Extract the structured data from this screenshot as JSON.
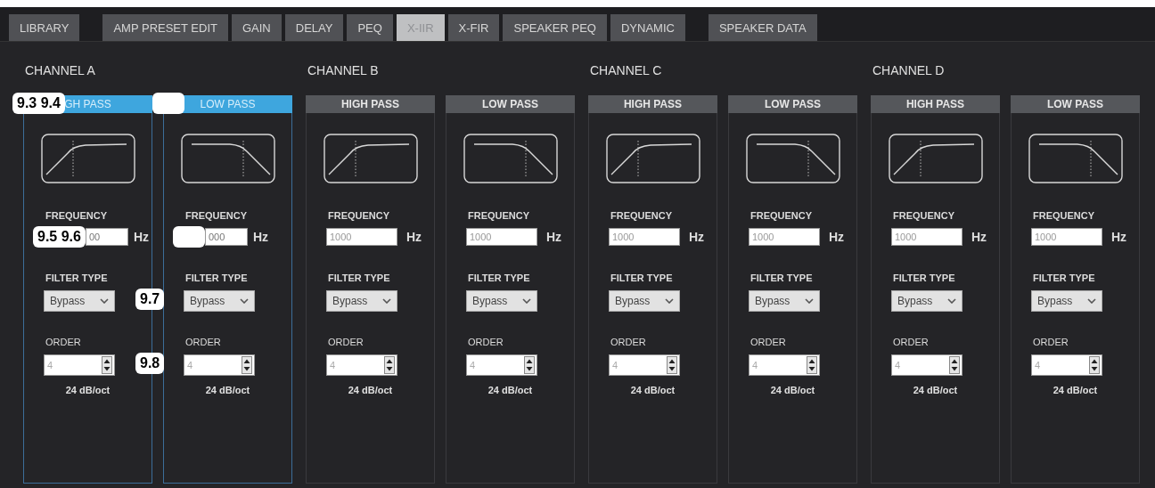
{
  "tabs": [
    {
      "label": "LIBRARY",
      "selected": false
    },
    {
      "label": "AMP PRESET EDIT",
      "selected": false
    },
    {
      "label": "GAIN",
      "selected": false
    },
    {
      "label": "DELAY",
      "selected": false
    },
    {
      "label": "PEQ",
      "selected": false
    },
    {
      "label": "X-IIR",
      "selected": true
    },
    {
      "label": "X-FIR",
      "selected": false
    },
    {
      "label": "SPEAKER PEQ",
      "selected": false
    },
    {
      "label": "DYNAMIC",
      "selected": false
    },
    {
      "label": "SPEAKER DATA",
      "selected": false
    }
  ],
  "channels": [
    {
      "name": "CHANNEL A",
      "filters": [
        {
          "kind": "high",
          "title": "GH PASS",
          "selected": true,
          "title_callout": {
            "kind": "label",
            "text": "9.3 9.4"
          },
          "frequency_label": "FREQUENCY",
          "frequency": "00",
          "frequency_callout": {
            "kind": "label",
            "text": "9.5 9.6"
          },
          "unit": "Hz",
          "filter_type_label": "FILTER TYPE",
          "filter_type": "Bypass",
          "order_label": "ORDER",
          "order": "4",
          "slope": "24 dB/oct"
        },
        {
          "kind": "low",
          "title": "LOW PASS",
          "selected": true,
          "title_callout": {
            "kind": "blank"
          },
          "frequency_label": "FREQUENCY",
          "frequency": "000",
          "frequency_callout": {
            "kind": "blank"
          },
          "unit": "Hz",
          "filter_type_label": "FILTER TYPE",
          "filter_type": "Bypass",
          "filter_type_callout": {
            "kind": "label",
            "text": "9.7"
          },
          "order_label": "ORDER",
          "order": "4",
          "order_callout": {
            "kind": "label",
            "text": "9.8"
          },
          "slope": "24 dB/oct"
        }
      ]
    },
    {
      "name": "CHANNEL B",
      "filters": [
        {
          "kind": "high",
          "title": "HIGH PASS",
          "selected": false,
          "frequency_label": "FREQUENCY",
          "frequency": "1000",
          "unit": "Hz",
          "filter_type_label": "FILTER TYPE",
          "filter_type": "Bypass",
          "order_label": "ORDER",
          "order": "4",
          "slope": "24 dB/oct"
        },
        {
          "kind": "low",
          "title": "LOW PASS",
          "selected": false,
          "frequency_label": "FREQUENCY",
          "frequency": "1000",
          "unit": "Hz",
          "filter_type_label": "FILTER TYPE",
          "filter_type": "Bypass",
          "order_label": "ORDER",
          "order": "4",
          "slope": "24 dB/oct"
        }
      ]
    },
    {
      "name": "CHANNEL C",
      "filters": [
        {
          "kind": "high",
          "title": "HIGH PASS",
          "selected": false,
          "frequency_label": "FREQUENCY",
          "frequency": "1000",
          "unit": "Hz",
          "filter_type_label": "FILTER TYPE",
          "filter_type": "Bypass",
          "order_label": "ORDER",
          "order": "4",
          "slope": "24 dB/oct"
        },
        {
          "kind": "low",
          "title": "LOW PASS",
          "selected": false,
          "frequency_label": "FREQUENCY",
          "frequency": "1000",
          "unit": "Hz",
          "filter_type_label": "FILTER TYPE",
          "filter_type": "Bypass",
          "order_label": "ORDER",
          "order": "4",
          "slope": "24 dB/oct"
        }
      ]
    },
    {
      "name": "CHANNEL D",
      "filters": [
        {
          "kind": "high",
          "title": "HIGH PASS",
          "selected": false,
          "frequency_label": "FREQUENCY",
          "frequency": "1000",
          "unit": "Hz",
          "filter_type_label": "FILTER TYPE",
          "filter_type": "Bypass",
          "order_label": "ORDER",
          "order": "4",
          "slope": "24 dB/oct"
        },
        {
          "kind": "low",
          "title": "LOW PASS",
          "selected": false,
          "frequency_label": "FREQUENCY",
          "frequency": "1000",
          "unit": "Hz",
          "filter_type_label": "FILTER TYPE",
          "filter_type": "Bypass",
          "order_label": "ORDER",
          "order": "4",
          "slope": "24 dB/oct"
        }
      ]
    }
  ]
}
